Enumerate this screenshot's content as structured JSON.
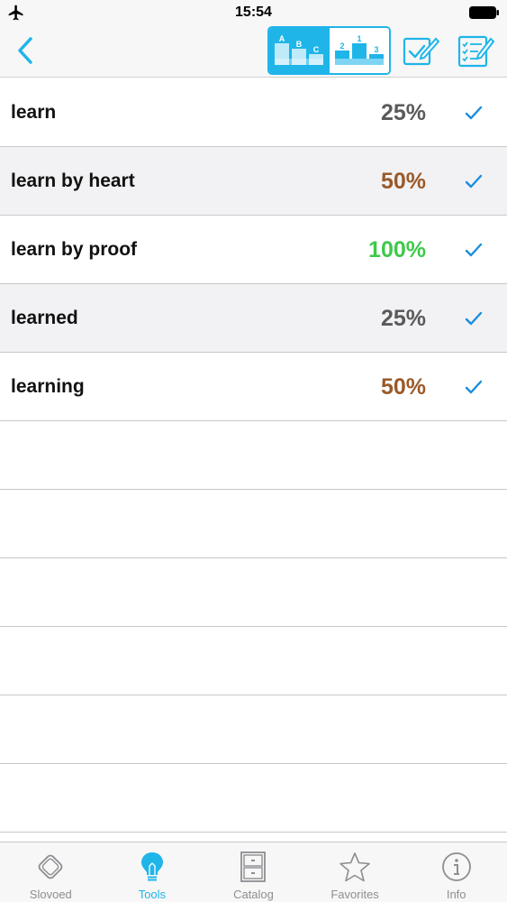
{
  "status_bar": {
    "time": "15:54"
  },
  "colors": {
    "accent": "#1fb5e9",
    "check": "#1a8de0",
    "pct_gray": "#5a5a5a",
    "pct_brown": "#9a5a2a",
    "pct_green": "#3ec94a",
    "tab_inactive": "#8e8e93"
  },
  "toolbar": {
    "sort_alpha": {
      "letters": [
        "A",
        "B",
        "C"
      ]
    },
    "sort_rank": {
      "numbers": [
        "2",
        "1",
        "3"
      ]
    }
  },
  "words": [
    {
      "word": "learn",
      "percent": "25%",
      "color": "#5a5a5a",
      "checked": true
    },
    {
      "word": "learn by heart",
      "percent": "50%",
      "color": "#9a5a2a",
      "checked": true
    },
    {
      "word": "learn by proof",
      "percent": "100%",
      "color": "#3ec94a",
      "checked": true
    },
    {
      "word": "learned",
      "percent": "25%",
      "color": "#5a5a5a",
      "checked": true
    },
    {
      "word": "learning",
      "percent": "50%",
      "color": "#9a5a2a",
      "checked": true
    }
  ],
  "tabs": [
    {
      "label": "Slovoed",
      "icon": "slovoed-logo-icon",
      "active": false
    },
    {
      "label": "Tools",
      "icon": "lightbulb-icon",
      "active": true
    },
    {
      "label": "Catalog",
      "icon": "cabinet-icon",
      "active": false
    },
    {
      "label": "Favorites",
      "icon": "star-icon",
      "active": false
    },
    {
      "label": "Info",
      "icon": "info-icon",
      "active": false
    }
  ]
}
